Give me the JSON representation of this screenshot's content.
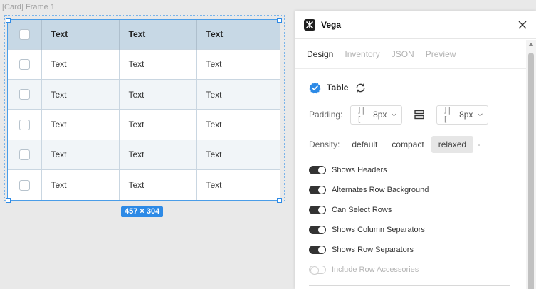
{
  "canvas": {
    "frame_label": "[Card] Frame 1",
    "size_badge": "457 × 304",
    "table": {
      "headers": [
        "Text",
        "Text",
        "Text"
      ],
      "rows": [
        [
          "Text",
          "Text",
          "Text"
        ],
        [
          "Text",
          "Text",
          "Text"
        ],
        [
          "Text",
          "Text",
          "Text"
        ],
        [
          "Text",
          "Text",
          "Text"
        ],
        [
          "Text",
          "Text",
          "Text"
        ]
      ]
    }
  },
  "panel": {
    "title": "Vega",
    "tabs": [
      {
        "label": "Design",
        "active": true
      },
      {
        "label": "Inventory",
        "active": false
      },
      {
        "label": "JSON",
        "active": false
      },
      {
        "label": "Preview",
        "active": false
      }
    ],
    "component": {
      "name": "Table",
      "badge_icon": "verified-badge-icon",
      "sync_icon": "sync-icon"
    },
    "padding": {
      "label": "Padding:",
      "horizontal": "8px",
      "vertical": "8px"
    },
    "density": {
      "label": "Density:",
      "options": [
        "default",
        "compact",
        "relaxed"
      ],
      "selected": "relaxed",
      "extra": "-"
    },
    "toggles": [
      {
        "label": "Shows Headers",
        "on": true,
        "disabled": false
      },
      {
        "label": "Alternates Row Background",
        "on": true,
        "disabled": false
      },
      {
        "label": "Can Select Rows",
        "on": true,
        "disabled": false
      },
      {
        "label": "Shows Column Separators",
        "on": true,
        "disabled": false
      },
      {
        "label": "Shows Row Separators",
        "on": true,
        "disabled": false
      },
      {
        "label": "Include Row Accessories",
        "on": false,
        "disabled": true
      }
    ]
  },
  "colors": {
    "selection": "#2d8ae6",
    "header_bg": "#c7d8e5",
    "alt_row_bg": "#f1f5f8",
    "badge_blue": "#2d8ae6"
  }
}
